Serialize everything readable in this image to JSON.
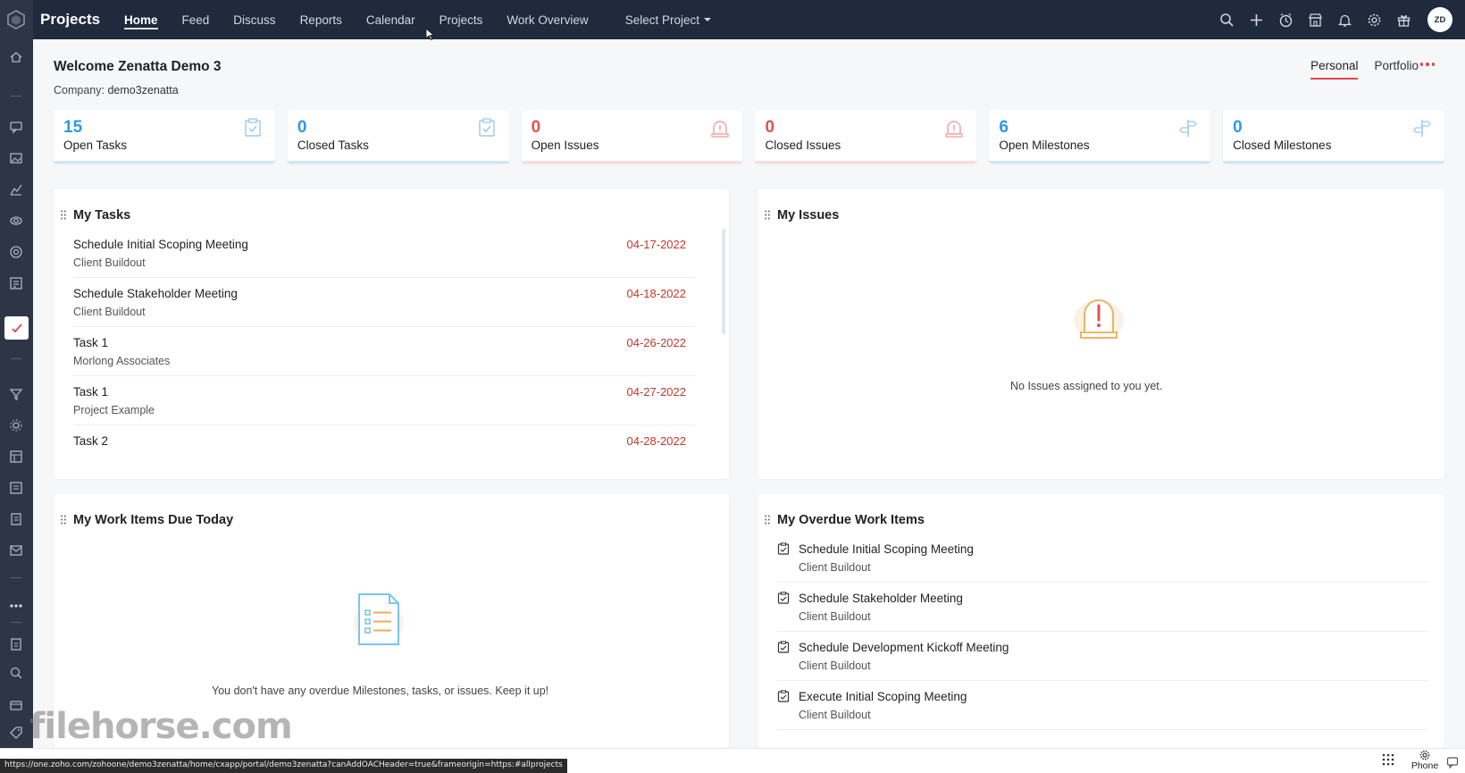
{
  "app": {
    "title": "Projects"
  },
  "nav": {
    "tabs": [
      "Home",
      "Feed",
      "Discuss",
      "Reports",
      "Calendar",
      "Projects",
      "Work Overview"
    ],
    "active": "Home",
    "select_project": "Select Project"
  },
  "user": {
    "initials": "ZD"
  },
  "header": {
    "welcome": "Welcome Zenatta Demo 3",
    "company_label": "Company",
    "company_value": "demo3zenatta",
    "view_personal": "Personal",
    "view_portfolio": "Portfolio"
  },
  "stats": [
    {
      "value": "15",
      "label": "Open Tasks",
      "icon": "task-icon",
      "tone": "blue"
    },
    {
      "value": "0",
      "label": "Closed Tasks",
      "icon": "task-icon",
      "tone": "blue"
    },
    {
      "value": "0",
      "label": "Open Issues",
      "icon": "issue-bell-icon",
      "tone": "red"
    },
    {
      "value": "0",
      "label": "Closed Issues",
      "icon": "issue-bell-icon",
      "tone": "red"
    },
    {
      "value": "6",
      "label": "Open Milestones",
      "icon": "signpost-icon",
      "tone": "blue"
    },
    {
      "value": "0",
      "label": "Closed Milestones",
      "icon": "signpost-icon",
      "tone": "blue"
    }
  ],
  "my_tasks": {
    "title": "My Tasks",
    "items": [
      {
        "name": "Schedule Initial Scoping Meeting",
        "project": "Client Buildout",
        "date": "04-17-2022"
      },
      {
        "name": "Schedule Stakeholder Meeting",
        "project": "Client Buildout",
        "date": "04-18-2022"
      },
      {
        "name": "Task 1",
        "project": "Morlong Associates",
        "date": "04-26-2022"
      },
      {
        "name": "Task 1",
        "project": "Project Example",
        "date": "04-27-2022"
      },
      {
        "name": "Task 2",
        "project": "",
        "date": "04-28-2022"
      }
    ]
  },
  "my_issues": {
    "title": "My Issues",
    "empty_text": "No Issues assigned to you yet."
  },
  "due_today": {
    "title": "My Work Items Due Today",
    "empty_text": "You don't have any overdue Milestones, tasks, or issues. Keep it up!"
  },
  "overdue": {
    "title": "My Overdue Work Items",
    "items": [
      {
        "name": "Schedule Initial Scoping Meeting",
        "project": "Client Buildout"
      },
      {
        "name": "Schedule Stakeholder Meeting",
        "project": "Client Buildout"
      },
      {
        "name": "Schedule Development Kickoff Meeting",
        "project": "Client Buildout"
      },
      {
        "name": "Execute Initial Scoping Meeting",
        "project": "Client Buildout"
      }
    ]
  },
  "statusbar": {
    "url": "https://one.zoho.com/zohoone/demo3zenatta/home/cxapp/portal/demo3zenatta?canAddOACHeader=true&frameorigin=https:#allprojects",
    "phone_label": "Phone",
    "watermark": "filehorse.com"
  },
  "colors": {
    "nav_bg": "#1f2a3d",
    "rail_bg": "#2e3646",
    "accent_red": "#e04848",
    "blue": "#2c9be5",
    "date_red": "#c0392b"
  }
}
